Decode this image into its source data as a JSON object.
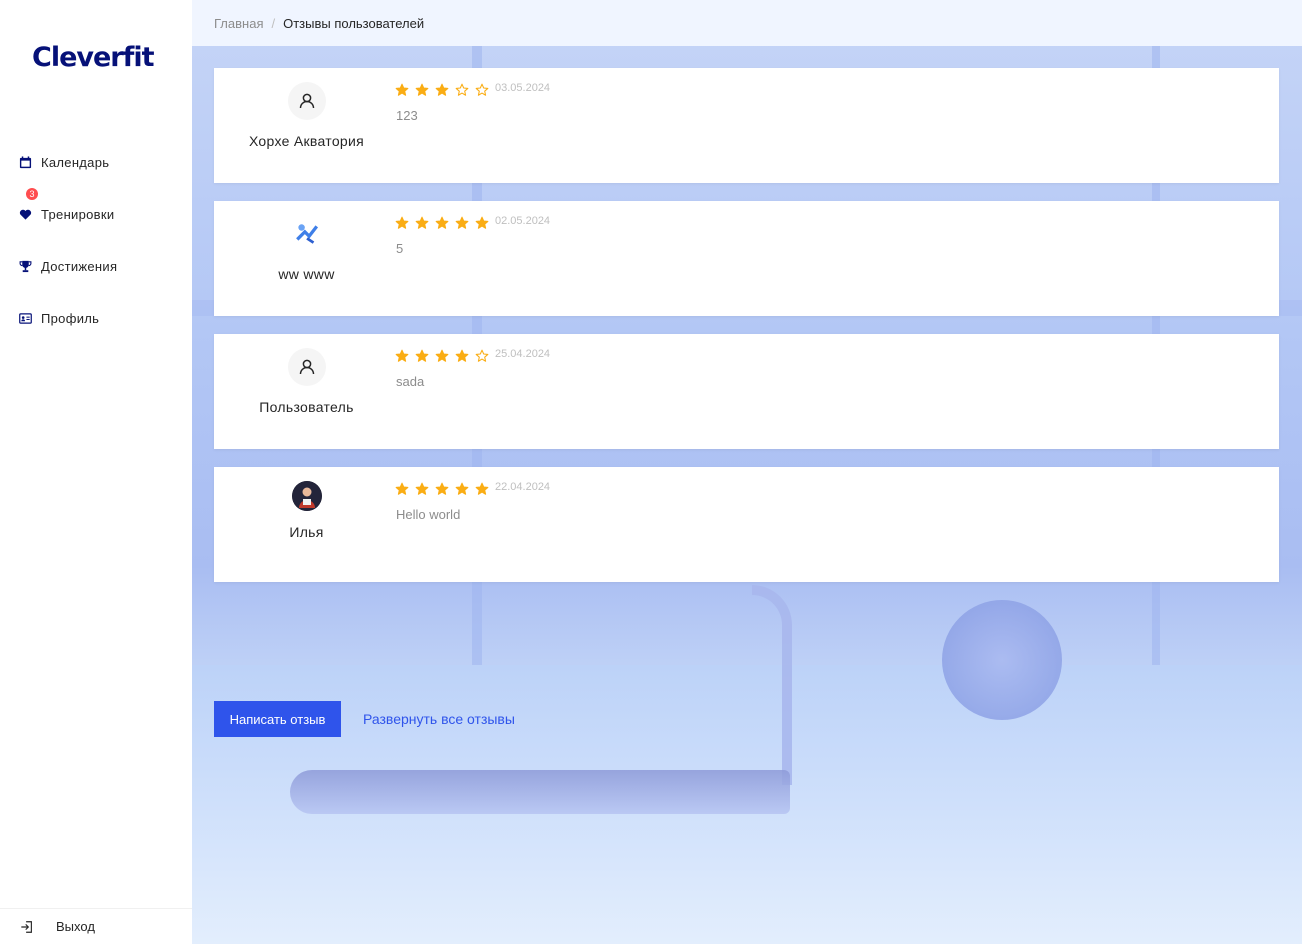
{
  "app": {
    "logo": "Cleverfit"
  },
  "sidebar": {
    "items": [
      {
        "label": "Календарь",
        "icon": "calendar-icon"
      },
      {
        "label": "Тренировки",
        "icon": "heart-icon",
        "badge": "3"
      },
      {
        "label": "Достижения",
        "icon": "trophy-icon"
      },
      {
        "label": "Профиль",
        "icon": "idcard-icon"
      }
    ],
    "logout_label": "Выход"
  },
  "breadcrumb": {
    "home": "Главная",
    "separator": "/",
    "current": "Отзывы пользователей"
  },
  "reviews": [
    {
      "name": "Хорхе Акватория",
      "avatar": "user-icon",
      "rating": 3,
      "date": "03.05.2024",
      "text": "123"
    },
    {
      "name": "ww www",
      "avatar": "custom-image",
      "rating": 5,
      "date": "02.05.2024",
      "text": "5"
    },
    {
      "name": "Пользователь",
      "avatar": "user-icon",
      "rating": 4,
      "date": "25.04.2024",
      "text": "sada"
    },
    {
      "name": "Илья",
      "avatar": "photo",
      "rating": 5,
      "date": "22.04.2024",
      "text": "Hello world"
    }
  ],
  "actions": {
    "write_review": "Написать отзыв",
    "expand_all": "Развернуть все отзывы"
  },
  "colors": {
    "accent": "#2f54eb",
    "star": "#faad14",
    "badge": "#ff4d4f",
    "logo": "#061178"
  }
}
